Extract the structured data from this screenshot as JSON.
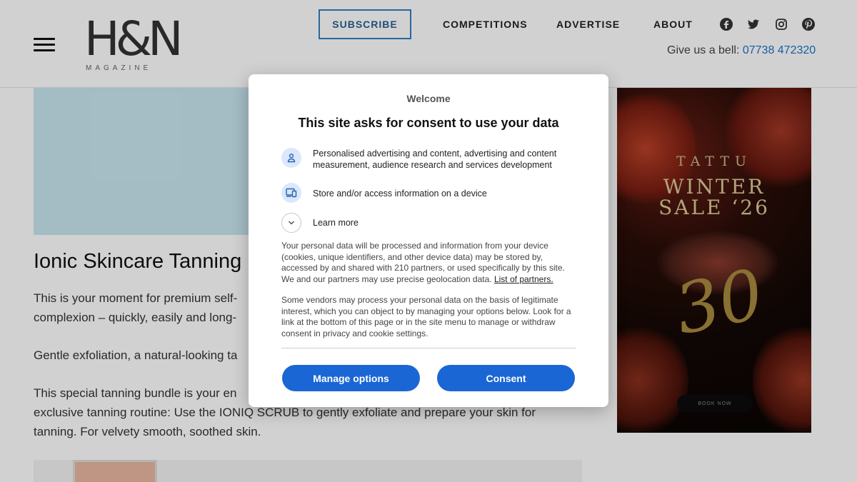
{
  "header": {
    "logo_text": "H&N",
    "logo_sub": "MAGAZINE",
    "nav": {
      "subscribe": "SUBSCRIBE",
      "competitions": "COMPETITIONS",
      "advertise": "ADVERTISE",
      "about": "ABOUT"
    },
    "social_icons": [
      "facebook-icon",
      "twitter-icon",
      "instagram-icon",
      "pinterest-icon"
    ],
    "phone_label": "Give us a bell:",
    "phone_number": "07738 472320"
  },
  "article": {
    "title": "Ionic Skincare Tanning",
    "para1_line1": "This is your moment for premium self-",
    "para1_line2": "complexion – quickly, easily and long-",
    "para2": "Gentle exfoliation, a natural-looking ta",
    "para3_line1": "This special tanning bundle is your en",
    "para3_line2": "exclusive tanning routine: Use the IONIQ SCRUB to gently exfoliate and prepare your skin for",
    "para3_line3": "tanning. For velvety smooth, soothed skin."
  },
  "ad": {
    "brand": "TATTU",
    "headline_line1": "WINTER",
    "headline_line2": "SALE ‘26",
    "number": "30",
    "cta": "BOOK NOW"
  },
  "consent": {
    "welcome": "Welcome",
    "title": "This site asks for consent to use your data",
    "item1": "Personalised advertising and content, advertising and content measurement, audience research and services development",
    "item2": "Store and/or access information on a device",
    "learn_more": "Learn more",
    "body1": "Your personal data will be processed and information from your device (cookies, unique identifiers, and other device data) may be stored by, accessed by and shared with 210 partners, or used specifically by this site. We and our partners may use precise geolocation data.",
    "partners_link": "List of partners.",
    "body2": "Some vendors may process your personal data on the basis of legitimate interest, which you can object to by managing your options below. Look for a link at the bottom of this page or in the site menu to manage or withdraw consent in privacy and cookie settings.",
    "manage_button": "Manage options",
    "consent_button": "Consent"
  },
  "colors": {
    "accent": "#1a66d4",
    "link": "#1a73c9",
    "subscribe_border": "#2f7fc1"
  }
}
